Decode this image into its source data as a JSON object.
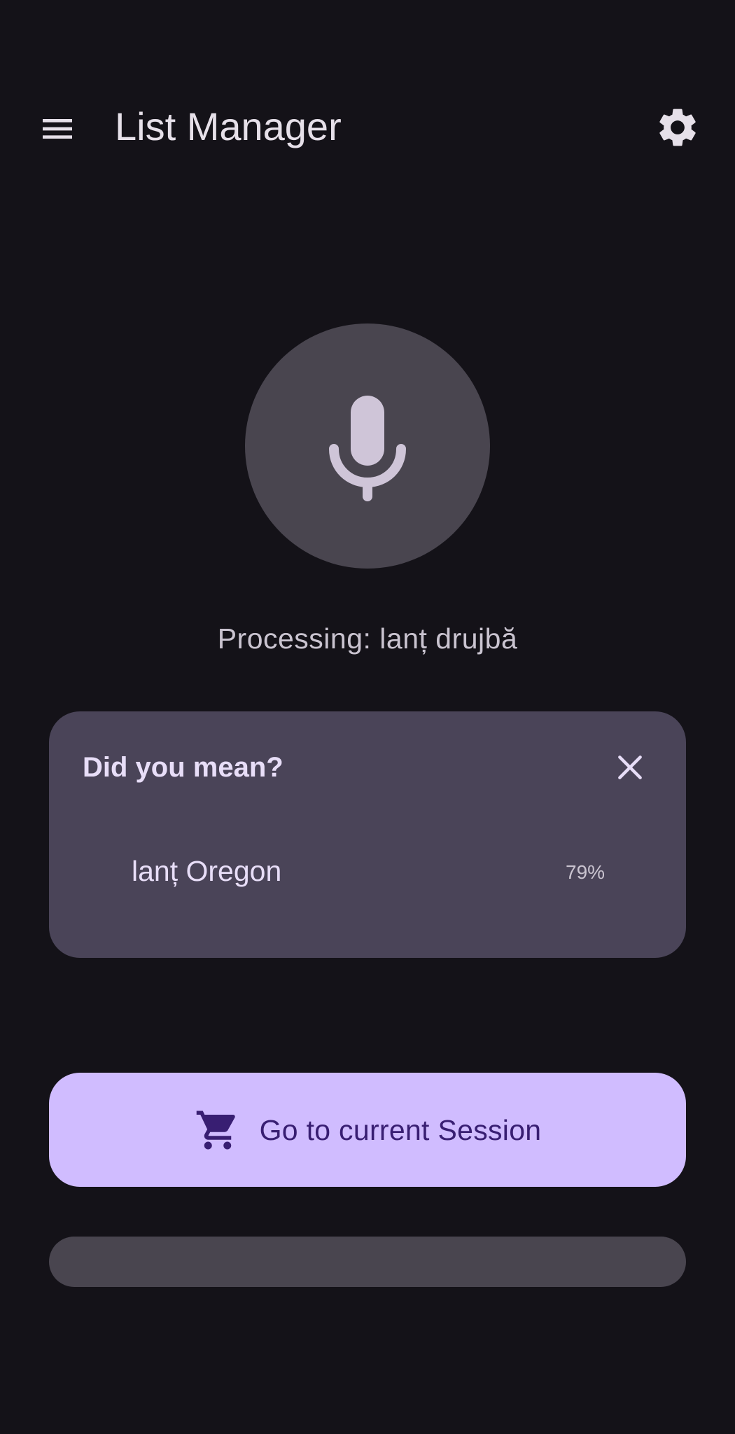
{
  "app_bar": {
    "title": "List Manager",
    "menu_icon": "menu-icon",
    "settings_icon": "gear-icon"
  },
  "voice": {
    "mic_icon": "microphone-icon",
    "processing_text": "Processing: lanț drujbă"
  },
  "suggestions": {
    "title": "Did you mean?",
    "close_icon": "close-icon",
    "items": [
      {
        "label": "lanț Oregon",
        "score": "79%"
      }
    ]
  },
  "actions": {
    "session_label": "Go to current Session",
    "session_icon": "shopping-cart-icon"
  },
  "colors": {
    "background": "#141218",
    "surface_variant": "#49454f",
    "card": "#4a4458",
    "primary_container": "#d0bcff",
    "on_primary": "#381e72",
    "text": "#e6e0e9"
  }
}
